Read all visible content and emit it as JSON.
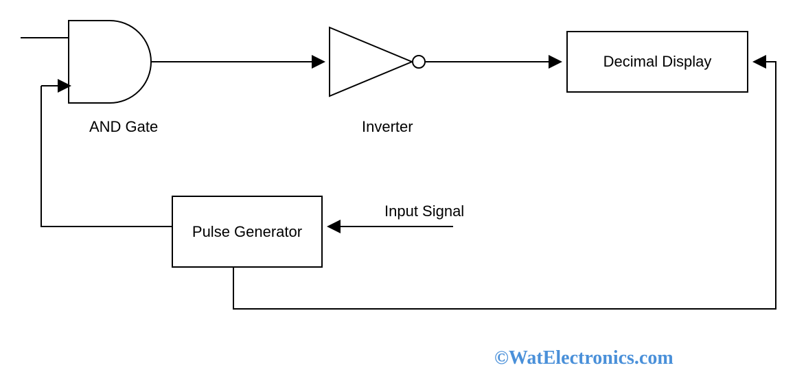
{
  "blocks": {
    "and_gate": {
      "label": "AND Gate"
    },
    "inverter": {
      "label": "Inverter"
    },
    "decimal_display": {
      "label": "Decimal Display"
    },
    "pulse_generator": {
      "label": "Pulse Generator"
    },
    "input_signal": {
      "label": "Input Signal"
    }
  },
  "watermark": "©WatElectronics.com"
}
